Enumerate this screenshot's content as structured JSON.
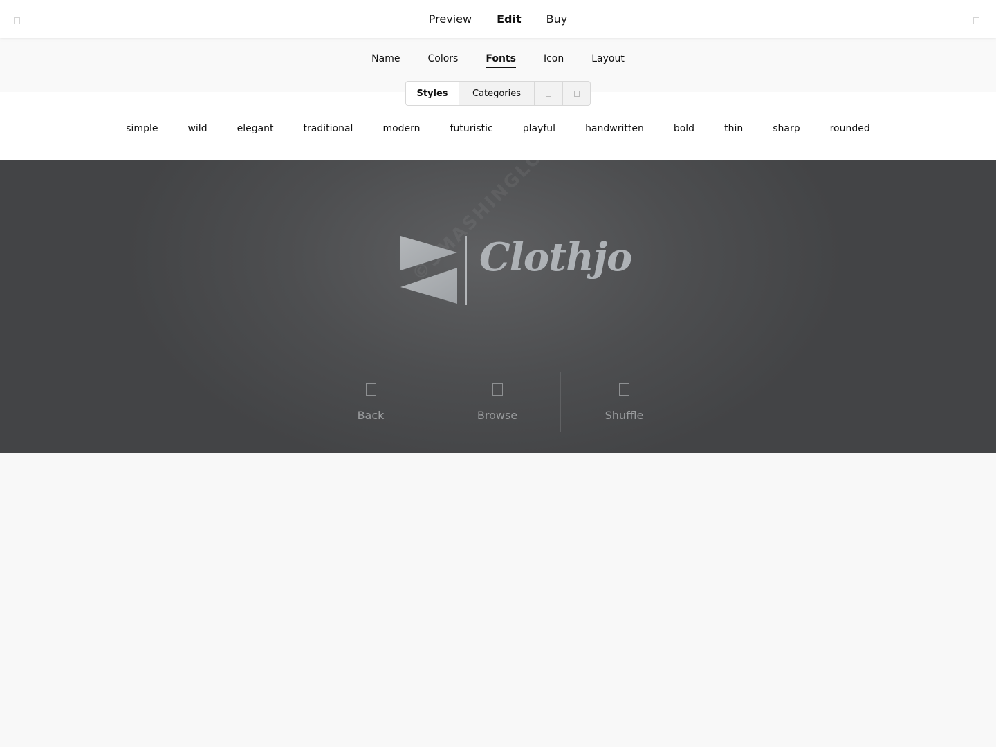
{
  "topnav": {
    "items": [
      {
        "label": "Preview",
        "active": false
      },
      {
        "label": "Edit",
        "active": true
      },
      {
        "label": "Buy",
        "active": false
      }
    ],
    "left_icon": "square-icon",
    "right_icon": "square-icon"
  },
  "tabs": [
    {
      "label": "Name",
      "active": false
    },
    {
      "label": "Colors",
      "active": false
    },
    {
      "label": "Fonts",
      "active": true
    },
    {
      "label": "Icon",
      "active": false
    },
    {
      "label": "Layout",
      "active": false
    }
  ],
  "segmented": {
    "styles": "Styles",
    "categories": "Categories",
    "icon3": "square-icon",
    "icon4": "square-icon"
  },
  "styles": [
    "simple",
    "wild",
    "elegant",
    "traditional",
    "modern",
    "futuristic",
    "playful",
    "handwritten",
    "bold",
    "thin",
    "sharp",
    "rounded"
  ],
  "preview": {
    "logo_name": "Clothjo",
    "watermark": "©SMASHINGLOGO",
    "actions": {
      "back": "Back",
      "browse": "Browse",
      "shuffle": "Shuffle"
    }
  },
  "colors": {
    "stage": "#4d4e50",
    "logo": "#aeb2b6"
  }
}
